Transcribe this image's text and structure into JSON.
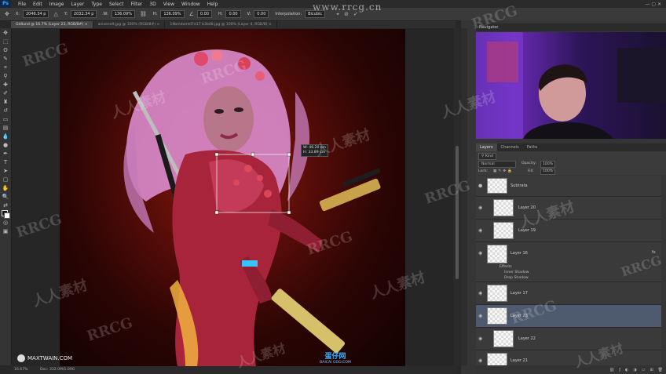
{
  "menubar": {
    "app_badge": "Ps",
    "items": [
      "File",
      "Edit",
      "Image",
      "Layer",
      "Type",
      "Select",
      "Filter",
      "3D",
      "View",
      "Window",
      "Help"
    ]
  },
  "site_watermark": "www.rrcg.cn",
  "options": {
    "x": "2046.34 p",
    "y": "2032.34 p",
    "w": "136.09%",
    "h": "136.09%",
    "angle": "0.00",
    "hskew": "0.00",
    "vskew": "0.00",
    "interp_label": "Interpolation:",
    "interp": "Bicubic"
  },
  "tabs": [
    {
      "label": "GIdlund @ 16.7% (Layer 23, RGB/8#) ×",
      "active": true
    },
    {
      "label": "anisenelt.jpg @ 100% (RGB/8#) ×",
      "active": false
    },
    {
      "label": "19bmdomld7e17 b3b48.jpg @ 100% (Layer 4, RGB/8) ×",
      "active": false
    }
  ],
  "transform_readout": {
    "w": "W: 46.20 cm",
    "h": "H: 33.89 cm"
  },
  "navigator": {
    "title": "Navigator"
  },
  "layers_panel": {
    "tabs": [
      "Layers",
      "Channels",
      "Paths"
    ],
    "kind": "Kind",
    "blend": "Normal",
    "opacity_label": "Opacity:",
    "opacity": "100%",
    "lock_label": "Lock:",
    "fill_label": "Fill:",
    "fill": "100%",
    "layers": [
      {
        "name": "Subtrata",
        "selected": false
      },
      {
        "name": "Layer 20",
        "selected": false
      },
      {
        "name": "Layer 19",
        "selected": false
      },
      {
        "name": "Layer 16",
        "selected": false
      },
      {
        "name": "Layer 17",
        "selected": false
      },
      {
        "name": "Layer 23",
        "selected": true
      },
      {
        "name": "Layer 22",
        "selected": false
      },
      {
        "name": "Layer 21",
        "selected": false
      }
    ],
    "effects": {
      "title": "Effects",
      "items": [
        "Inner Shadow",
        "Drop Shadow"
      ]
    },
    "fx": "fx"
  },
  "status": {
    "zoom": "16.67%",
    "doc": "Doc: 332.0M/1.09G"
  },
  "brand": "MAXTWAIN.COM",
  "bottom_logo": {
    "line1": "蛋仔网",
    "line2": "BAICAI GOO.COM"
  },
  "watermarks": [
    "RRCG",
    "人人素材"
  ]
}
